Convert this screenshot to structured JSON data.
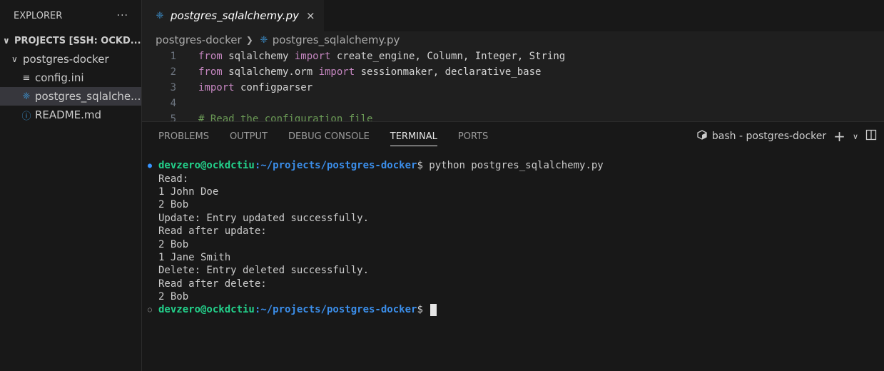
{
  "sidebar": {
    "title": "EXPLORER",
    "more": "···",
    "root": "PROJECTS [SSH: OCKD...",
    "folder": "postgres-docker",
    "files": [
      {
        "name": "config.ini",
        "icon": "config-icon",
        "glyph": "≡"
      },
      {
        "name": "postgres_sqlalche...",
        "icon": "python-icon",
        "glyph": "❈"
      },
      {
        "name": "README.md",
        "icon": "info-icon",
        "glyph": "ⓘ"
      }
    ]
  },
  "editor": {
    "tab_label": "postgres_sqlalchemy.py",
    "close": "×",
    "breadcrumb": {
      "folder": "postgres-docker",
      "file": "postgres_sqlalchemy.py"
    },
    "lines": [
      {
        "n": "1",
        "kw": "from",
        "a": " sqlalchemy ",
        "kw2": "import",
        "b": " create_engine, Column, Integer, String"
      },
      {
        "n": "2",
        "kw": "from",
        "a": " sqlalchemy.orm ",
        "kw2": "import",
        "b": " sessionmaker, declarative_base"
      },
      {
        "n": "3",
        "kw": "import",
        "a": " configparser",
        "kw2": "",
        "b": ""
      },
      {
        "n": "4",
        "kw": "",
        "a": "",
        "kw2": "",
        "b": ""
      },
      {
        "n": "5",
        "comment": "# Read the configuration file"
      }
    ]
  },
  "panel": {
    "tabs": [
      "PROBLEMS",
      "OUTPUT",
      "DEBUG CONSOLE",
      "TERMINAL",
      "PORTS"
    ],
    "active_tab": "TERMINAL",
    "terminal_name": "bash - postgres-docker",
    "add": "+",
    "dropdown": "∨"
  },
  "terminal": {
    "user": "devzero@ockdctiu",
    "path": ":~/projects/postgres-docker",
    "prompt": "$ ",
    "command": "python postgres_sqlalchemy.py",
    "output": [
      "Read:",
      "1 John Doe",
      "2 Bob",
      "Update: Entry updated successfully.",
      "Read after update:",
      "2 Bob",
      "1 Jane Smith",
      "Delete: Entry deleted successfully.",
      "Read after delete:",
      "2 Bob"
    ]
  },
  "colors": {
    "background": "#181818",
    "editor": "#1f1f1f",
    "keyword": "#c586c0",
    "prompt_user": "#23d18b",
    "prompt_path": "#3b8eea",
    "python_icon": "#3c8fcb"
  }
}
